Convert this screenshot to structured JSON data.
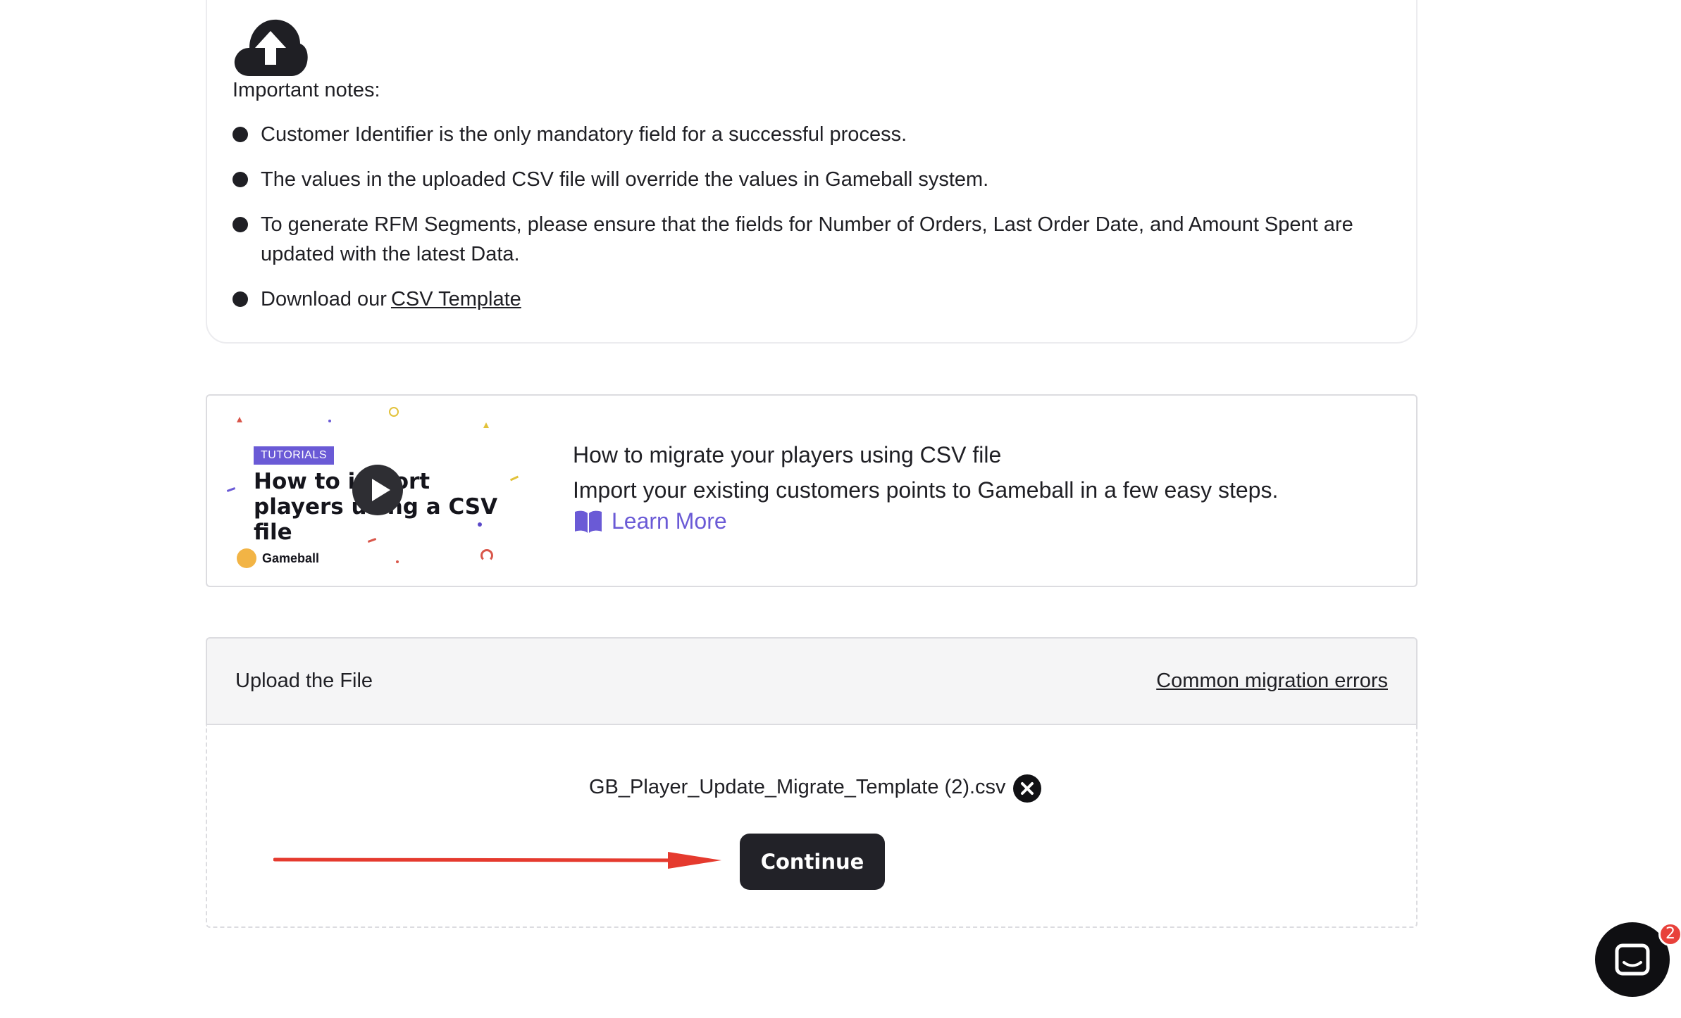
{
  "notes": {
    "title": "Important notes:",
    "items": [
      "Customer Identifier is the only mandatory field for a successful process.",
      "The values in the uploaded CSV file will override the values in Gameball system.",
      "To generate RFM Segments, please ensure that the fields for Number of Orders, Last Order Date, and Amount Spent are updated with the latest Data."
    ],
    "download_prefix": "Download our",
    "download_link": "CSV Template"
  },
  "tutorial": {
    "thumbnail": {
      "tag": "TUTORIALS",
      "headline": "How to import players using a CSV file",
      "brand": "Gameball"
    },
    "title": "How to migrate your players using CSV file",
    "description": "Import your existing customers points to Gameball in a few easy steps.",
    "learn_more": "Learn More",
    "accent_color": "#6a5ad6"
  },
  "upload": {
    "title": "Upload the File",
    "errors_link": "Common migration errors",
    "file_name": "GB_Player_Update_Migrate_Template (2).csv",
    "continue_label": "Continue"
  },
  "annotation": {
    "arrow_color": "#e53a2e"
  },
  "chat": {
    "badge_count": "2",
    "badge_color": "#e8413b"
  }
}
